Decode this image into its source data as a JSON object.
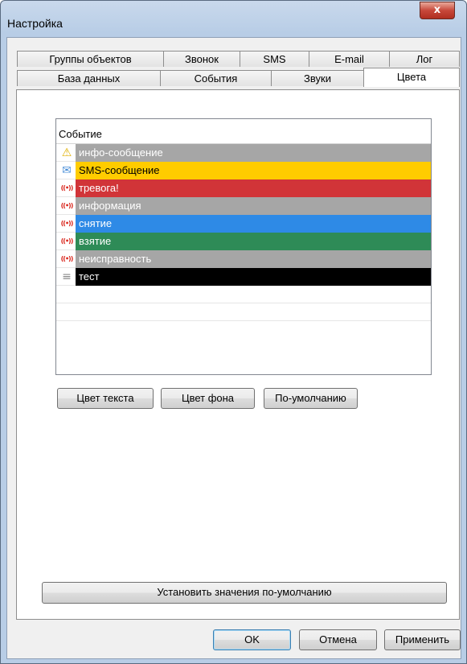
{
  "window": {
    "title": "Настройка",
    "close_glyph": "x"
  },
  "tabs_row1": [
    {
      "label": "Группы объектов"
    },
    {
      "label": "Звонок"
    },
    {
      "label": "SMS"
    },
    {
      "label": "E-mail"
    },
    {
      "label": "Лог"
    }
  ],
  "tabs_row2": [
    {
      "label": "База данных"
    },
    {
      "label": "События"
    },
    {
      "label": "Звуки"
    },
    {
      "label": "Цвета",
      "active": true
    }
  ],
  "events_list": {
    "header": "Событие",
    "rows": [
      {
        "label": "инфо-сообщение",
        "icon": "warning-icon",
        "glyph": "⚠",
        "bg": "#a6a6a6",
        "fg": "#ffffff",
        "icon_color": "#e0b000"
      },
      {
        "label": "SMS-сообщение",
        "icon": "envelope-icon",
        "glyph": "✉",
        "bg": "#ffcc00",
        "fg": "#000000",
        "icon_color": "#4a8fd8"
      },
      {
        "label": "тревога!",
        "icon": "radio-antenna-icon",
        "glyph": "((•))",
        "bg": "#d13438",
        "fg": "#ffffff",
        "icon_color": "#d9241a"
      },
      {
        "label": "информация",
        "icon": "radio-antenna-icon",
        "glyph": "((•))",
        "bg": "#a6a6a6",
        "fg": "#ffffff",
        "icon_color": "#d9241a"
      },
      {
        "label": "снятие",
        "icon": "radio-antenna-icon",
        "glyph": "((•))",
        "bg": "#2e8ae6",
        "fg": "#ffffff",
        "icon_color": "#d9241a"
      },
      {
        "label": "взятие",
        "icon": "radio-antenna-icon",
        "glyph": "((•))",
        "bg": "#2e8b57",
        "fg": "#ffffff",
        "icon_color": "#d9241a"
      },
      {
        "label": "неисправность",
        "icon": "radio-antenna-icon",
        "glyph": "((•))",
        "bg": "#a6a6a6",
        "fg": "#ffffff",
        "icon_color": "#d9241a"
      },
      {
        "label": "тест",
        "icon": "database-icon",
        "glyph": "≡",
        "bg": "#000000",
        "fg": "#ffffff",
        "icon_color": "#8a8a8a"
      }
    ]
  },
  "buttons": {
    "text_color": "Цвет текста",
    "bg_color": "Цвет фона",
    "default_color": "По-умолчанию",
    "reset_defaults": "Установить значения по-умолчанию",
    "ok": "OK",
    "cancel": "Отмена",
    "apply": "Применить"
  }
}
